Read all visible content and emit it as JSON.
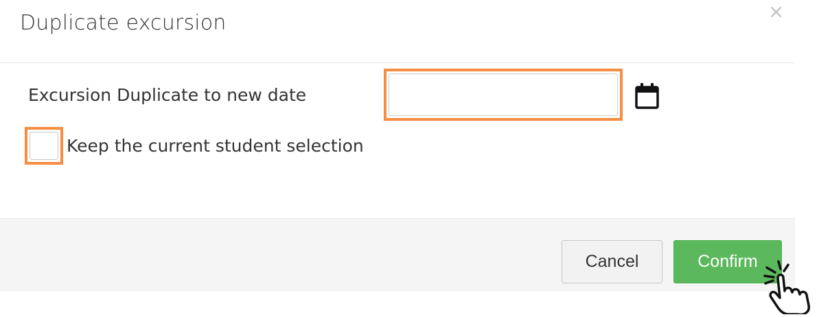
{
  "dialog": {
    "title": "Duplicate excursion",
    "close_icon": "close-icon"
  },
  "form": {
    "date_label": "Excursion Duplicate to new date",
    "date_value": "",
    "date_placeholder": "",
    "calendar_icon": "calendar-icon",
    "keep_selection_label": "Keep the current student selection",
    "keep_selection_checked": false
  },
  "footer": {
    "cancel_label": "Cancel",
    "confirm_label": "Confirm"
  },
  "annotations": {
    "highlight_color": "#f58d42",
    "click_indicator_icon": "hand-pointer-click-icon"
  },
  "colors": {
    "confirm_green": "#5cb85c",
    "footer_bg": "#f5f5f5"
  }
}
